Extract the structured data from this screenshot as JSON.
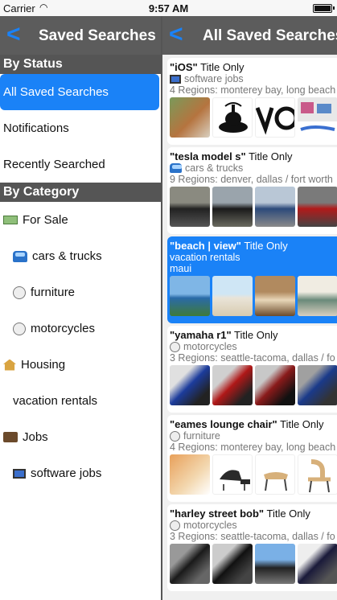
{
  "status_bar": {
    "carrier": "Carrier",
    "time": "9:57 AM"
  },
  "left": {
    "title": "Saved Searches",
    "section_status": "By Status",
    "status_items": [
      {
        "label": "All Saved Searches"
      },
      {
        "label": "Notifications"
      },
      {
        "label": "Recently Searched"
      }
    ],
    "section_category": "By Category",
    "category_items": [
      {
        "label": "For Sale",
        "icon": "money-icon"
      },
      {
        "label": "cars & trucks",
        "icon": "car-icon"
      },
      {
        "label": "furniture",
        "icon": "radio-icon"
      },
      {
        "label": "motorcycles",
        "icon": "radio-icon"
      },
      {
        "label": "Housing",
        "icon": "house-icon"
      },
      {
        "label": "vacation rentals",
        "icon": ""
      },
      {
        "label": "Jobs",
        "icon": "briefcase-icon"
      },
      {
        "label": "software jobs",
        "icon": "monitor-icon"
      }
    ]
  },
  "right": {
    "title": "All Saved Searches",
    "cards": [
      {
        "query": "\"iOS\"",
        "mode": "Title Only",
        "category": "software jobs",
        "cat_icon": "monitor-icon",
        "regions": "4 Regions: monterey bay, long beach"
      },
      {
        "query": "\"tesla model s\"",
        "mode": "Title Only",
        "category": "cars & trucks",
        "cat_icon": "car-icon",
        "regions": "9 Regions: denver, dallas / fort worth"
      },
      {
        "query": "\"beach | view\"",
        "mode": "Title Only",
        "category": "vacation rentals",
        "cat_icon": "",
        "regions": "maui"
      },
      {
        "query": "\"yamaha r1\"",
        "mode": "Title Only",
        "category": "motorcycles",
        "cat_icon": "radio-icon",
        "regions": "3 Regions: seattle-tacoma, dallas / fo"
      },
      {
        "query": "\"eames lounge chair\"",
        "mode": "Title Only",
        "category": "furniture",
        "cat_icon": "radio-icon",
        "regions": "4 Regions: monterey bay, long beach"
      },
      {
        "query": "\"harley street bob\"",
        "mode": "Title Only",
        "category": "motorcycles",
        "cat_icon": "radio-icon",
        "regions": "3 Regions: seattle-tacoma, dallas / fo"
      }
    ]
  },
  "colors": {
    "accent": "#1a82f7",
    "header": "#5c5c5c",
    "section": "#555555"
  }
}
